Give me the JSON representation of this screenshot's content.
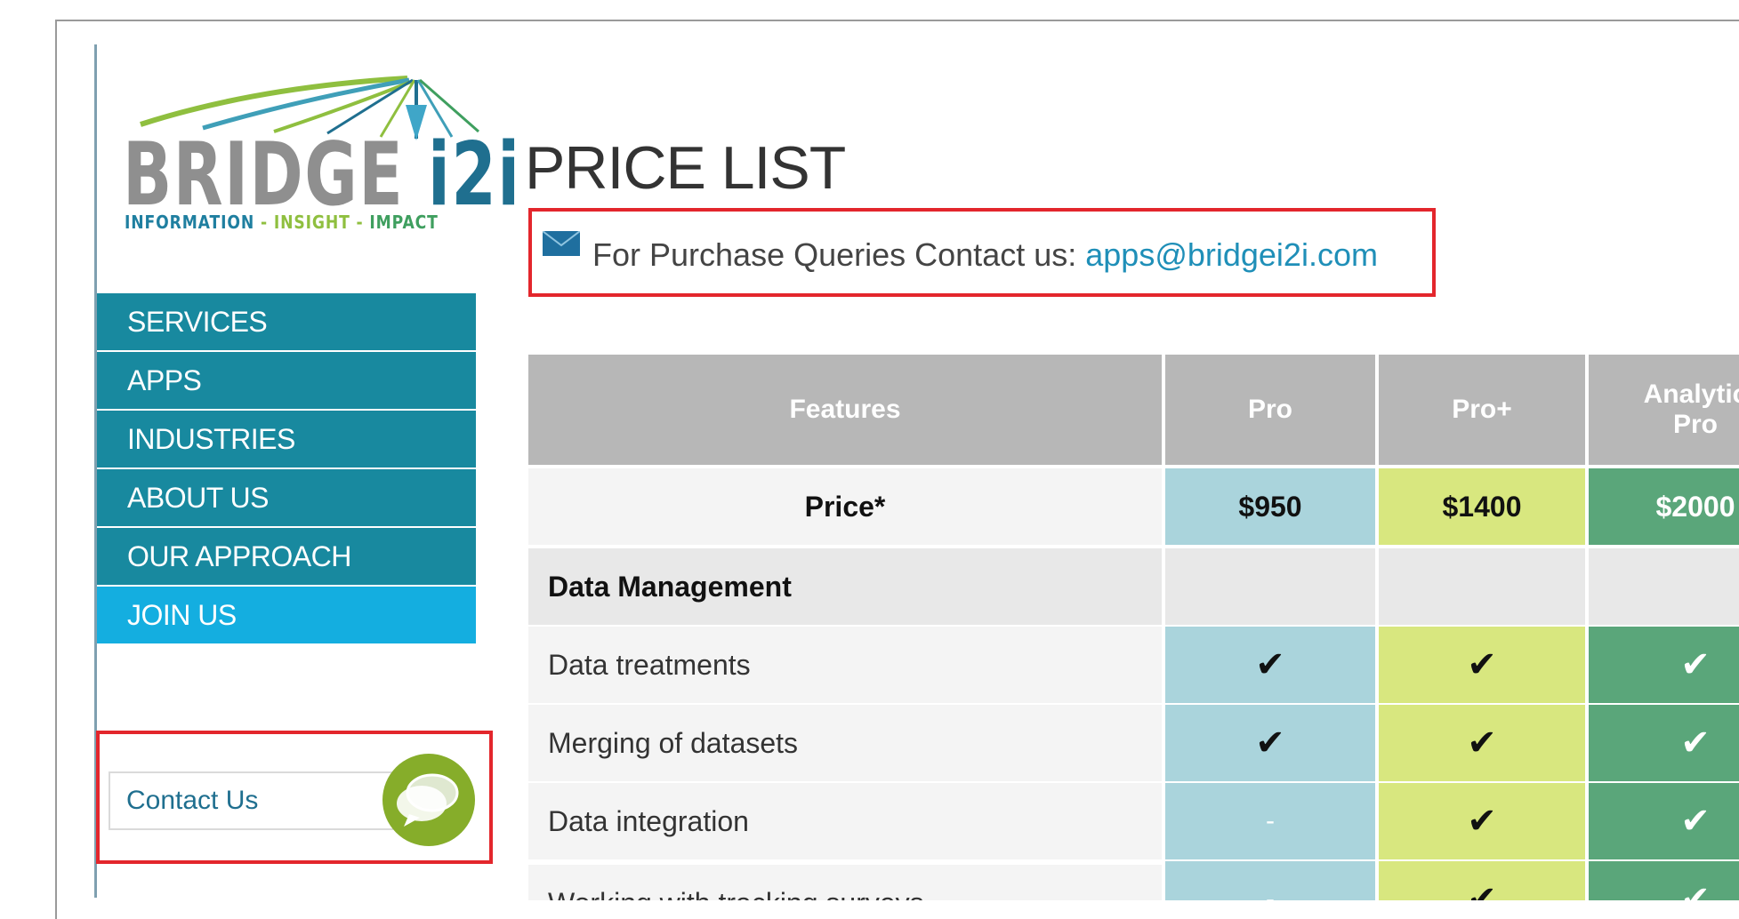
{
  "logo": {
    "word": "BRIDGE",
    "word_suffix": "i2i",
    "tagline_parts": [
      "INFORMATION",
      "INSIGHT",
      "IMPACT"
    ],
    "tagline_separator": " - "
  },
  "nav": {
    "items": [
      {
        "label": "SERVICES",
        "active": false
      },
      {
        "label": "APPS",
        "active": false
      },
      {
        "label": "INDUSTRIES",
        "active": false
      },
      {
        "label": "ABOUT US",
        "active": false
      },
      {
        "label": "OUR APPROACH",
        "active": false
      },
      {
        "label": "JOIN US",
        "active": true
      }
    ]
  },
  "contact": {
    "label": "Contact Us",
    "chat_icon": "chat-bubbles-icon"
  },
  "page": {
    "title": "PRICE LIST",
    "query_text": "For Purchase Queries Contact us: ",
    "query_email": "apps@bridgei2i.com",
    "mail_icon": "envelope-icon"
  },
  "table": {
    "headers": [
      "Features",
      "Pro",
      "Pro+",
      "Analytic\nPro"
    ],
    "header_lines": {
      "analytic_1": "Analytic",
      "analytic_2": "Pro"
    },
    "price_row": {
      "label": "Price*",
      "pro": "$950",
      "proplus": "$1400",
      "analytic": "$2000"
    },
    "section_label": "Data Management",
    "rows": [
      {
        "label": "Data treatments",
        "pro": "✔",
        "proplus": "✔",
        "analytic": "✔"
      },
      {
        "label": "Merging of datasets",
        "pro": "✔",
        "proplus": "✔",
        "analytic": "✔"
      },
      {
        "label": "Data integration",
        "pro": "-",
        "proplus": "✔",
        "analytic": "✔"
      },
      {
        "label": "Working with tracking surveys",
        "pro": "-",
        "proplus": "✔",
        "analytic": "✔"
      }
    ]
  },
  "colors": {
    "nav": "#18899f",
    "nav_active": "#14aee0",
    "highlight_border": "#e3262c",
    "pro": "#aad4dc",
    "proplus": "#d8e77f",
    "analytic": "#5aa67a",
    "header": "#b7b7b7"
  }
}
